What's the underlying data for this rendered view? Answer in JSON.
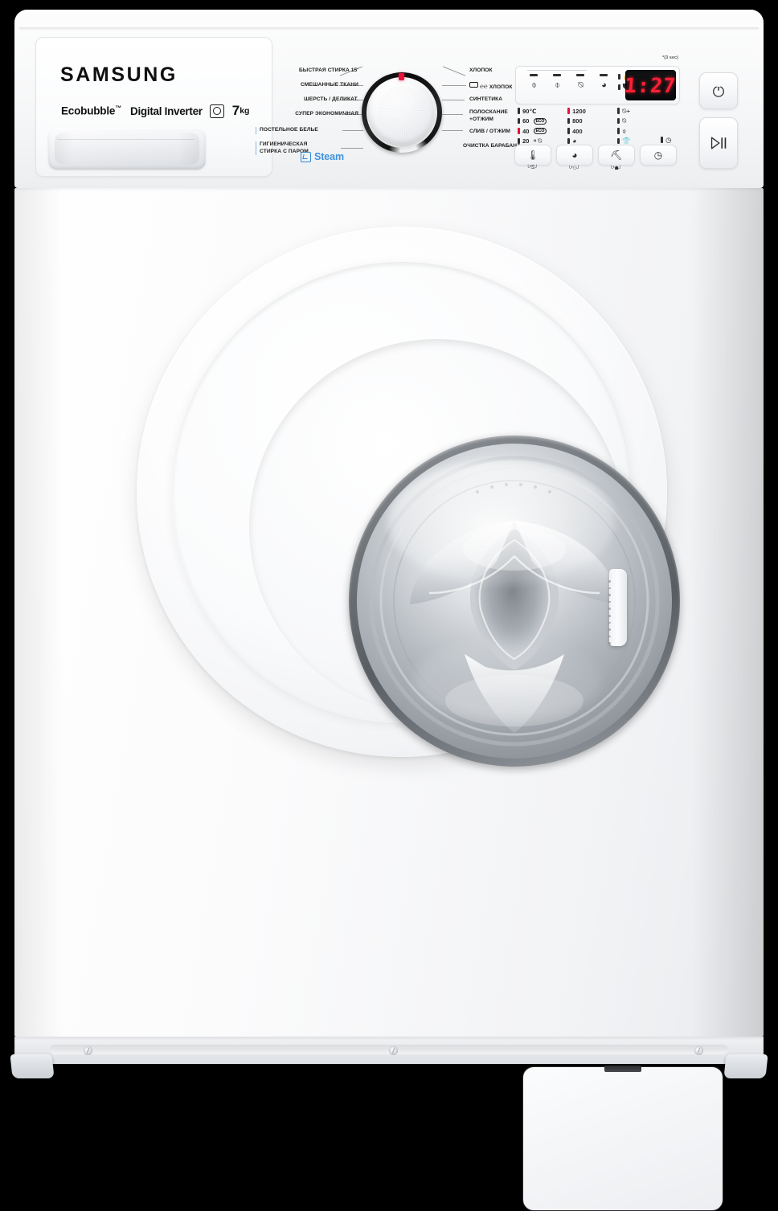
{
  "product": {
    "brand": "SAMSUNG",
    "feature_eco": "Ecobubble",
    "feature_tm": "™",
    "feature_inverter": "Digital Inverter",
    "capacity_value": "7",
    "capacity_unit": "kg",
    "drawer_name": "detergent-drawer"
  },
  "dial": {
    "left_programs": [
      "БЫСТРАЯ СТИРКА 15'",
      "СМЕШАННЫЕ ТКАНИ",
      "ШЕРСТЬ / ДЕЛИКАТ.",
      "СУПЕР ЭКОНОМИЧНАЯ",
      "ПОСТЕЛЬНОЕ БЕЛЬЕ",
      "ГИГИЕНИЧЕСКАЯ\nСТИРКА С ПАРОМ"
    ],
    "right_programs": [
      "ХЛОПОК",
      "ХЛОПОК",
      "СИНТЕТИКА",
      "ПОЛОСКАНИЕ\n+ОТЖИМ",
      "СЛИВ / ОТЖИМ",
      "ОЧИСТКА БАРАБАНА"
    ],
    "steam_label": "Steam",
    "marker_color": "#e8123a"
  },
  "display": {
    "hold_note": "*(3 sec)",
    "time_remaining": "1:27",
    "lcd_color": "#ff1f35",
    "phase_icons": [
      "wash-phase-icon",
      "rinse-phase-icon",
      "spin-phase-icon",
      "dry-phase-icon"
    ],
    "status_icons_a": [
      "child-lock-icon",
      "no-water-icon"
    ],
    "status_icons_b": [
      "door-lock-icon"
    ]
  },
  "options": {
    "temperature": [
      {
        "label": "90℃",
        "active": false
      },
      {
        "label": "60",
        "tag": "ECO",
        "active": false
      },
      {
        "label": "40",
        "tag": "ECO",
        "active": true
      },
      {
        "label": "20",
        "tag": "",
        "active": false,
        "icon": "cold-wash-icon"
      }
    ],
    "spin": [
      {
        "label": "1200",
        "active": true
      },
      {
        "label": "800",
        "active": false
      },
      {
        "label": "400",
        "active": false
      },
      {
        "label": "",
        "active": false,
        "icon": "no-spin-icon"
      }
    ],
    "extras": [
      {
        "icon": "prewash-icon",
        "active": false
      },
      {
        "icon": "intensive-icon",
        "active": false
      },
      {
        "icon": "extra-rinse-icon",
        "active": false
      },
      {
        "icon": "easy-iron-icon",
        "active": false
      }
    ],
    "delay": [
      {
        "icon": "delay-end-icon",
        "active": false
      }
    ],
    "buttons": [
      {
        "name": "temperature-button",
        "glyph": "🌡",
        "hold": "└*⚿┘"
      },
      {
        "name": "spin-button",
        "glyph": "◎",
        "hold": "└*⚇┘"
      },
      {
        "name": "rinse-plus-button",
        "glyph": "☂",
        "hold": "└*☗┘"
      },
      {
        "name": "delay-end-button",
        "glyph": "◷",
        "hold": ""
      }
    ]
  },
  "controls": {
    "power_label": "power-button",
    "start_label": "start-pause-button"
  }
}
